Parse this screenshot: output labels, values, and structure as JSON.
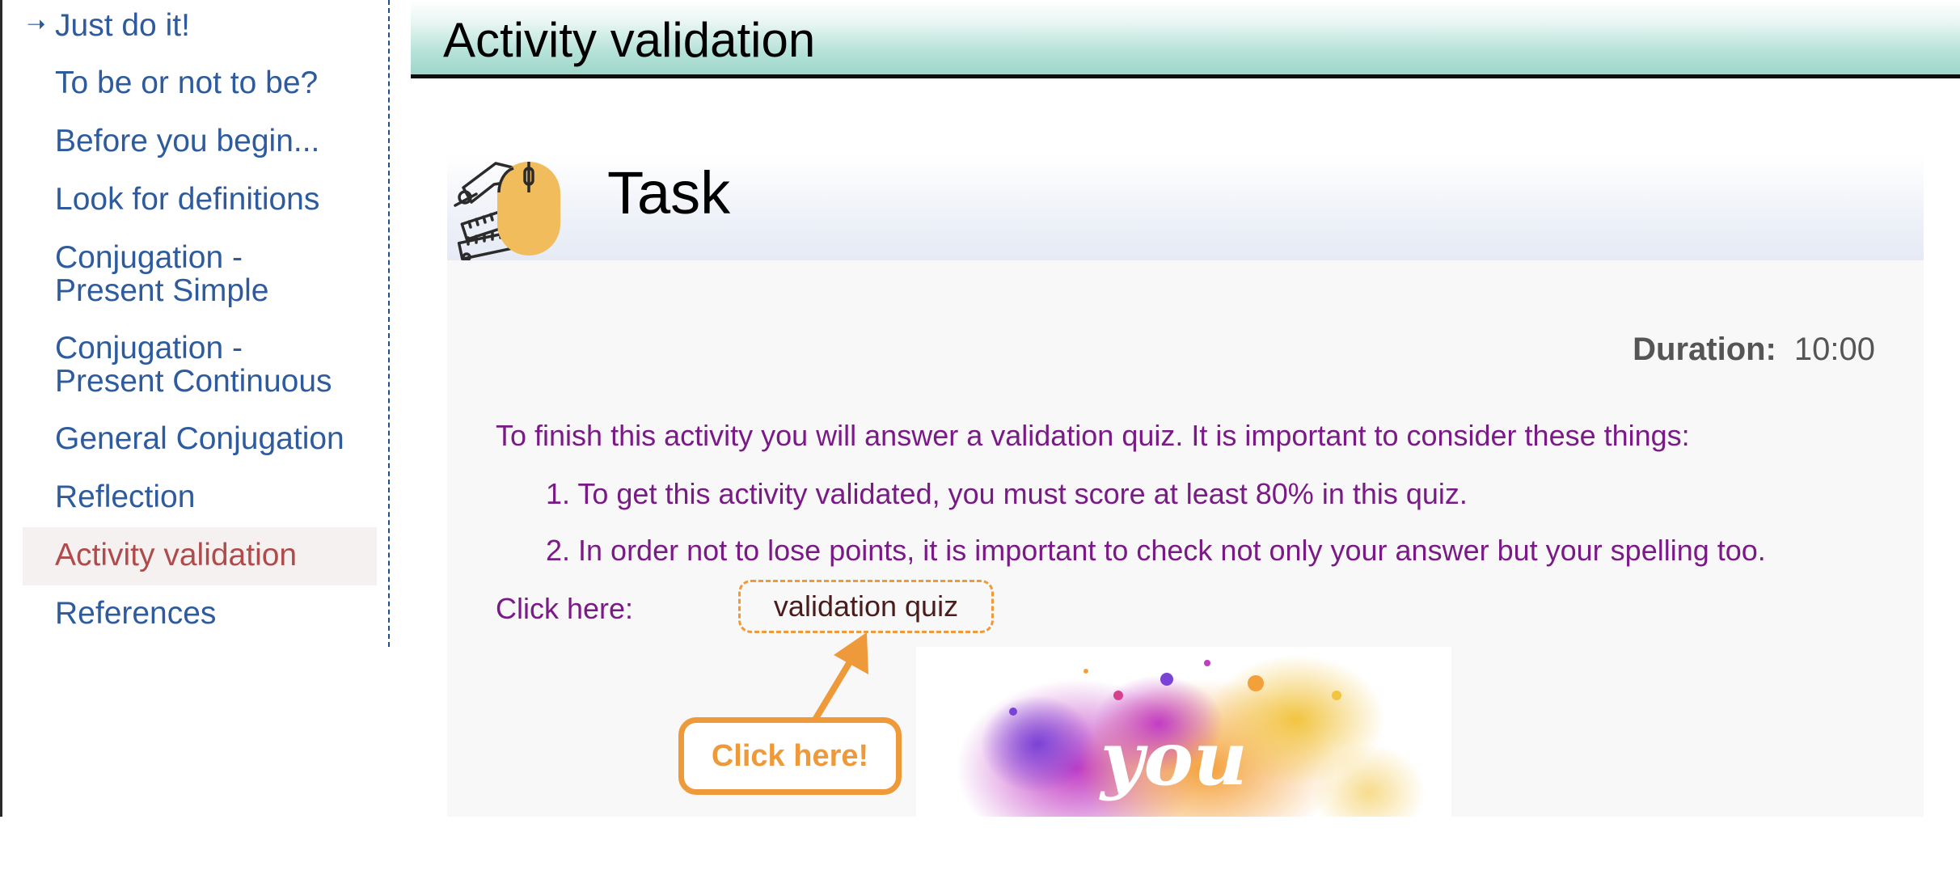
{
  "sidebar": {
    "items": [
      {
        "label": "Just do it!",
        "active": false,
        "icon": "arrow-right-icon"
      },
      {
        "label": "To be or not to be?",
        "active": false
      },
      {
        "label": "Before you begin...",
        "active": false
      },
      {
        "label": "Look for definitions",
        "active": false
      },
      {
        "label_lines": [
          "Conjugation -",
          "Present Simple"
        ],
        "active": false
      },
      {
        "label_lines": [
          "Conjugation -",
          "Present Continuous"
        ],
        "active": false
      },
      {
        "label": "General Conjugation",
        "active": false
      },
      {
        "label": "Reflection",
        "active": false
      },
      {
        "label": "Activity validation",
        "active": true
      },
      {
        "label": "References",
        "active": false
      }
    ]
  },
  "page": {
    "title": "Activity validation"
  },
  "task": {
    "icon": "mouse-tools-icon",
    "title": "Task",
    "duration_label": "Duration:",
    "duration_value": "10:00",
    "intro": "To finish this activity you will answer a validation quiz. It is important to consider these things:",
    "steps": [
      "1. To get this activity validated, you must score at least 80% in this quiz.",
      "2. In order not to lose points, it is important to check not only your answer but your spelling too."
    ],
    "click_here_label": "Click here:",
    "quiz_link_label": "validation quiz",
    "callout_label": "Click here!",
    "image_text": "you"
  },
  "colors": {
    "nav_link": "#2d5b9d",
    "nav_active": "#b04b4b",
    "body_text": "#7a1a86",
    "accent_orange": "#ef9a3a",
    "header_teal": "#9fd6ca"
  }
}
